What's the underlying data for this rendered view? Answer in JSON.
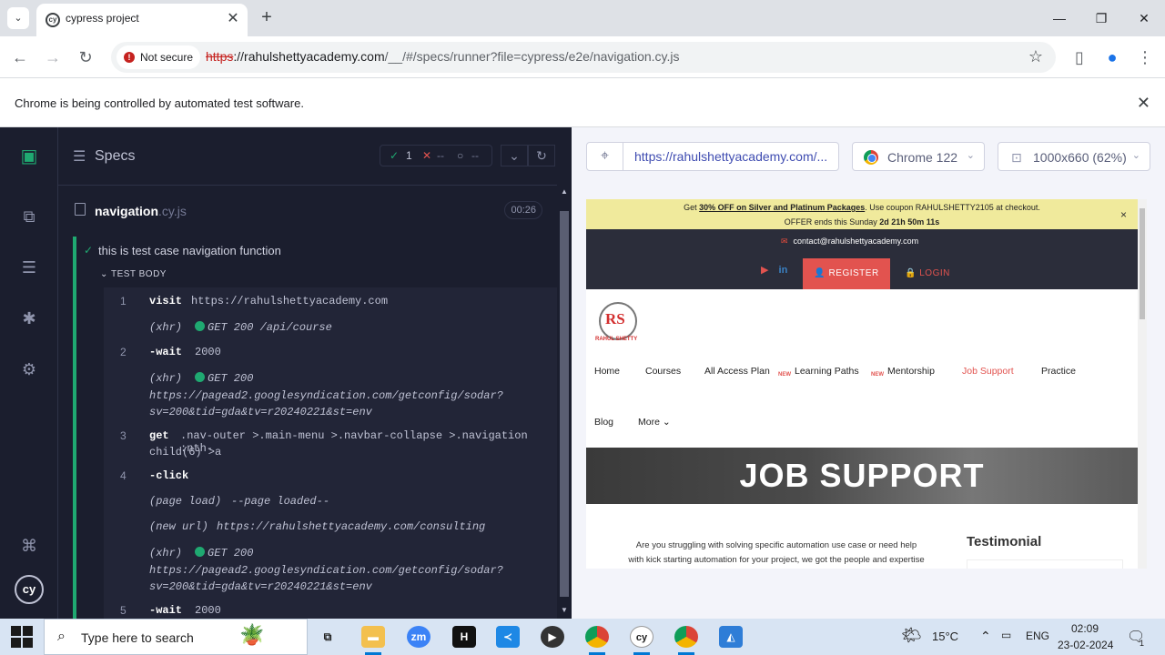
{
  "browser": {
    "tab_title": "cypress project",
    "tab_close": "✕",
    "new_tab": "+",
    "window_controls": {
      "minimize": "—",
      "maximize": "❐",
      "close": "✕"
    },
    "security_chip": "Not secure",
    "url_scheme": "https",
    "url_host": "://rahulshettyacademy.com",
    "url_rest": "/__/#/specs/runner?file=cypress/e2e/navigation.cy.js",
    "infobar_text": "Chrome is being controlled by automated test software.",
    "infobar_close": "✕"
  },
  "reporter": {
    "specs_label": "Specs",
    "passed_count": "1",
    "failed_count": "--",
    "pending_count": "--",
    "spec_file_name": "navigation",
    "spec_file_ext": ".cy.js",
    "duration": "00:26",
    "test_title": "this is test case navigation function",
    "test_body_label": "TEST BODY",
    "commands": [
      {
        "num": "1",
        "name": "visit",
        "msg": "https://rahulshettyacademy.com"
      },
      {
        "num": "",
        "name": "(xhr)",
        "msg": "GET 200 /api/course"
      },
      {
        "num": "2",
        "name": "-wait",
        "msg": "2000"
      },
      {
        "num": "",
        "name": "(xhr)",
        "msg": "GET 200"
      },
      {
        "num": "",
        "name": "",
        "msg": "https://pagead2.googlesyndication.com/getconfig/sodar?"
      },
      {
        "num": "",
        "name": "",
        "msg": "sv=200&tid=gda&tv=r20240221&st=env"
      },
      {
        "num": "3",
        "name": "get",
        "msg": ".nav-outer >.main-menu >.navbar-collapse >.navigation :nth-"
      },
      {
        "num": "",
        "name": "",
        "msg": "child(6) >a"
      },
      {
        "num": "4",
        "name": "-click",
        "msg": ""
      },
      {
        "num": "",
        "name": "(page load)",
        "msg": "--page loaded--"
      },
      {
        "num": "",
        "name": "(new url)",
        "msg": "https://rahulshettyacademy.com/consulting"
      },
      {
        "num": "",
        "name": "(xhr)",
        "msg": "GET 200"
      },
      {
        "num": "",
        "name": "",
        "msg": "https://pagead2.googlesyndication.com/getconfig/sodar?"
      },
      {
        "num": "",
        "name": "",
        "msg": "sv=200&tid=gda&tv=r20240221&st=env"
      },
      {
        "num": "5",
        "name": "-wait",
        "msg": "2000"
      }
    ]
  },
  "app": {
    "aut_url": "https://rahulshettyacademy.com/...",
    "browser_label": "Chrome 122",
    "viewport_label": "1000x660 (62%)"
  },
  "site": {
    "promo_pre": "Get ",
    "promo_bold": "30% OFF on Silver and Platinum Packages",
    "promo_post": ". Use coupon RAHULSHETTY2105 at checkout.",
    "promo_line2_pre": "OFFER ends this Sunday ",
    "promo_countdown": "2d 21h 50m 11s",
    "contact_email": "contact@rahulshettyacademy.com",
    "register": "REGISTER",
    "login": "LOGIN",
    "logo_text": "RS",
    "logo_sub": "RAHUL SHETTY",
    "menu": [
      "Home",
      "Courses",
      "All Access Plan",
      "Learning Paths",
      "Mentorship",
      "Job Support",
      "Practice",
      "Blog",
      "More"
    ],
    "new_tag": "NEW",
    "hero_title": "JOB SUPPORT",
    "body_line1": "Are you struggling with solving specific automation use case or need help",
    "body_line2": "with kick starting automation for your project, we got the people and expertise",
    "testimonial_heading": "Testimonial"
  },
  "taskbar": {
    "search_placeholder": "Type here to search",
    "weather": "15°C",
    "language": "ENG",
    "time": "02:09",
    "date": "23-02-2024",
    "notification_count": "1"
  },
  "colors": {
    "cypress_bg": "#1b1e2e",
    "pass_green": "#1fa971",
    "accent_red": "#e2534f"
  }
}
